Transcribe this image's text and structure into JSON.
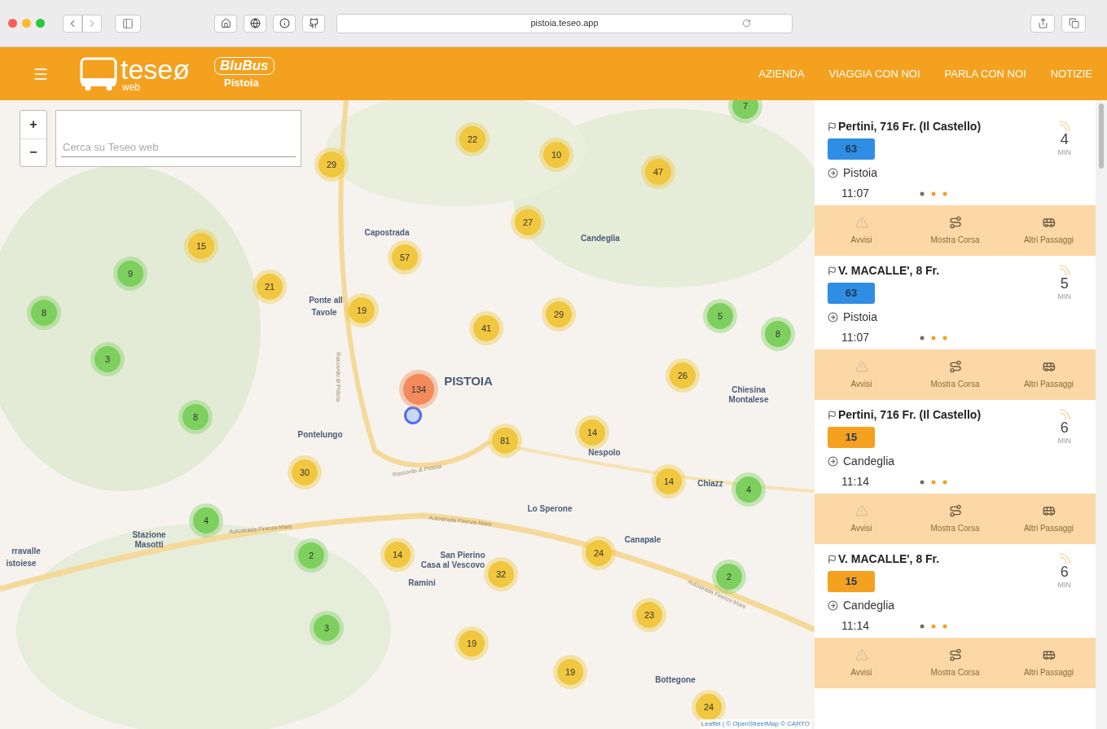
{
  "browser": {
    "url": "pistoia.teseo.app"
  },
  "header": {
    "logo": {
      "name": "teseø",
      "sub": "web"
    },
    "brand": {
      "name": "BluBus",
      "city": "Pistoia"
    },
    "nav": [
      {
        "label": "AZIENDA"
      },
      {
        "label": "VIAGGIA CON NOI"
      },
      {
        "label": "PARLA CON NOI"
      },
      {
        "label": "NOTIZIE"
      }
    ]
  },
  "map": {
    "zoom": [
      "+",
      "−"
    ],
    "search": {
      "placeholder": "Cerca su Teseo web"
    },
    "places": [
      {
        "name": "Capostrada"
      },
      {
        "name": "Candeglia"
      },
      {
        "name": "Ponte all"
      },
      {
        "name": "Tavole"
      },
      {
        "name": "PISTOIA",
        "major": true
      },
      {
        "name": "Chiesina"
      },
      {
        "name": "Montalese"
      },
      {
        "name": "Pontelungo"
      },
      {
        "name": "Nespolo"
      },
      {
        "name": "Chiazz"
      },
      {
        "name": "Lo Sperone"
      },
      {
        "name": "Stazione"
      },
      {
        "name": "Masotti"
      },
      {
        "name": "Canapale"
      },
      {
        "name": "San Pierino"
      },
      {
        "name": "Casa al Vescovo"
      },
      {
        "name": "Ramini"
      },
      {
        "name": "rravalle"
      },
      {
        "name": "istoiese"
      },
      {
        "name": "Bottegone"
      }
    ],
    "roads": [
      {
        "name": "Raccordo di Pistoia"
      },
      {
        "name": "Raccordo di Pistoia"
      },
      {
        "name": "Autostrada Firenze-Mare"
      },
      {
        "name": "Autostrada Firenze-Mare"
      },
      {
        "name": "Autostrada Firenze-Mare"
      }
    ],
    "clusters": [
      {
        "count": "7",
        "color": "#7dcf5e"
      },
      {
        "count": "22",
        "color": "#f0c73e"
      },
      {
        "count": "10",
        "color": "#f0c73e"
      },
      {
        "count": "47",
        "color": "#f0c73e"
      },
      {
        "count": "29",
        "color": "#f0c73e"
      },
      {
        "count": "27",
        "color": "#f0c73e"
      },
      {
        "count": "15",
        "color": "#f0c73e"
      },
      {
        "count": "57",
        "color": "#f0c73e"
      },
      {
        "count": "9",
        "color": "#7dcf5e"
      },
      {
        "count": "21",
        "color": "#f0c73e"
      },
      {
        "count": "8",
        "color": "#7dcf5e"
      },
      {
        "count": "19",
        "color": "#f0c73e"
      },
      {
        "count": "29",
        "color": "#f0c73e"
      },
      {
        "count": "41",
        "color": "#f0c73e"
      },
      {
        "count": "5",
        "color": "#7dcf5e"
      },
      {
        "count": "8",
        "color": "#7dcf5e"
      },
      {
        "count": "3",
        "color": "#7dcf5e"
      },
      {
        "count": "26",
        "color": "#f0c73e"
      },
      {
        "count": "134",
        "color": "#f28a5c"
      },
      {
        "count": "8",
        "color": "#7dcf5e"
      },
      {
        "count": "81",
        "color": "#f0c73e"
      },
      {
        "count": "14",
        "color": "#f0c73e"
      },
      {
        "count": "30",
        "color": "#f0c73e"
      },
      {
        "count": "14",
        "color": "#f0c73e"
      },
      {
        "count": "4",
        "color": "#7dcf5e"
      },
      {
        "count": "4",
        "color": "#7dcf5e"
      },
      {
        "count": "2",
        "color": "#7dcf5e"
      },
      {
        "count": "14",
        "color": "#f0c73e"
      },
      {
        "count": "24",
        "color": "#f0c73e"
      },
      {
        "count": "32",
        "color": "#f0c73e"
      },
      {
        "count": "2",
        "color": "#7dcf5e"
      },
      {
        "count": "23",
        "color": "#f0c73e"
      },
      {
        "count": "3",
        "color": "#7dcf5e"
      },
      {
        "count": "19",
        "color": "#f0c73e"
      },
      {
        "count": "19",
        "color": "#f0c73e"
      },
      {
        "count": "24",
        "color": "#f0c73e"
      }
    ],
    "attribution": "Leaflet | © OpenStreetMap © CARTO"
  },
  "arrivals": [
    {
      "stop": "Pertini, 716 Fr. (Il Castello)",
      "line": "63",
      "color": "#2f8de4",
      "destination": "Pistoia",
      "time": "11:07",
      "minutes": "4",
      "unit": "MIN",
      "actions": [
        {
          "kind": "alerts",
          "label": "Avvisi"
        },
        {
          "kind": "route",
          "label": "Mostra Corsa"
        },
        {
          "kind": "departures",
          "label": "Altri Passaggi"
        }
      ]
    },
    {
      "stop": "V. MACALLE', 8 Fr.",
      "line": "63",
      "color": "#2f8de4",
      "destination": "Pistoia",
      "time": "11:07",
      "minutes": "5",
      "unit": "MIN",
      "actions": [
        {
          "kind": "alerts",
          "label": "Avvisi"
        },
        {
          "kind": "route",
          "label": "Mostra Corsa"
        },
        {
          "kind": "departures",
          "label": "Altri Passaggi"
        }
      ]
    },
    {
      "stop": "Pertini, 716 Fr. (Il Castello)",
      "line": "15",
      "color": "#f4a11f",
      "destination": "Candeglia",
      "time": "11:14",
      "minutes": "6",
      "unit": "MIN",
      "actions": [
        {
          "kind": "alerts",
          "label": "Avvisi"
        },
        {
          "kind": "route",
          "label": "Mostra Corsa"
        },
        {
          "kind": "departures",
          "label": "Altri Passaggi"
        }
      ]
    },
    {
      "stop": "V. MACALLE', 8 Fr.",
      "line": "15",
      "color": "#f4a11f",
      "destination": "Candeglia",
      "time": "11:14",
      "minutes": "6",
      "unit": "MIN",
      "actions": [
        {
          "kind": "alerts",
          "label": "Avvisi"
        },
        {
          "kind": "route",
          "label": "Mostra Corsa"
        },
        {
          "kind": "departures",
          "label": "Altri Passaggi"
        }
      ]
    }
  ]
}
